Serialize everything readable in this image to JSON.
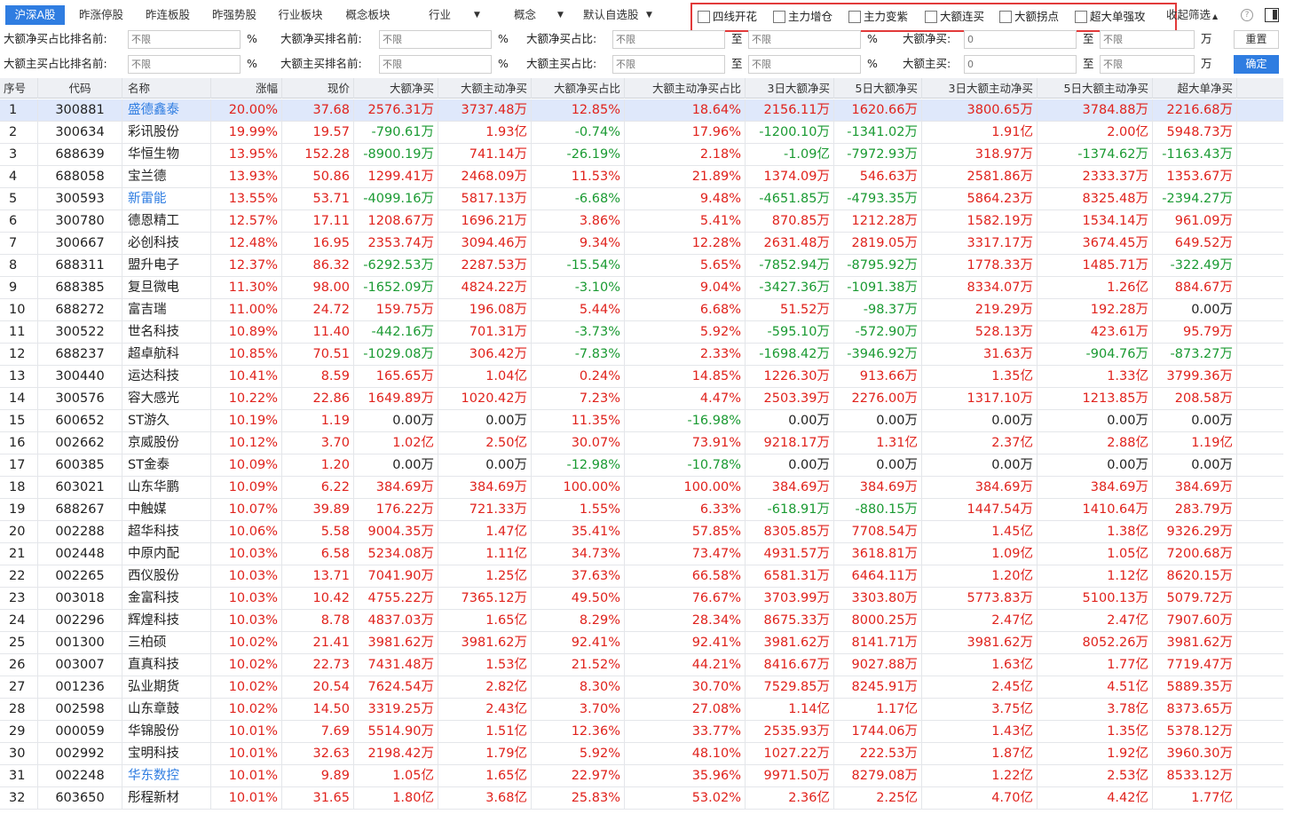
{
  "tabs": [
    "沪深A股",
    "昨涨停股",
    "昨连板股",
    "昨强势股",
    "行业板块",
    "概念板块"
  ],
  "active_tab": 0,
  "dropdowns": [
    "行业",
    "概念",
    "默认自选股"
  ],
  "checkboxes": [
    "四线开花",
    "主力增仓",
    "主力变紫",
    "大额连买",
    "大额拐点",
    "超大单强攻"
  ],
  "collapse_label": "收起筛选",
  "filters": {
    "row1": {
      "f1": "大额净买占比排名前:",
      "f2": "大额净买排名前:",
      "f3": "大额净买占比:",
      "f4": "大额净买:"
    },
    "row2": {
      "f1": "大额主买占比排名前:",
      "f2": "大额主买排名前:",
      "f3": "大额主买占比:",
      "f4": "大额主买:"
    },
    "placeholder": "不限",
    "zero_value": "0",
    "to": "至",
    "pct": "%",
    "unit": "万",
    "reset": "重置",
    "confirm": "确定"
  },
  "columns": [
    "序号",
    "代码",
    "名称",
    "涨幅",
    "现价",
    "大额净买",
    "大额主动净买",
    "大额净买占比",
    "大额主动净买占比",
    "3日大额净买",
    "5日大额净买",
    "3日大额主动净买",
    "5日大额主动净买",
    "超大单净买"
  ],
  "rows": [
    [
      "1",
      "300881",
      "盛德鑫泰",
      "20.00%",
      "37.68",
      "2576.31万",
      "3737.48万",
      "12.85%",
      "18.64%",
      "2156.11万",
      "1620.66万",
      "3800.65万",
      "3784.88万",
      "2216.68万"
    ],
    [
      "2",
      "300634",
      "彩讯股份",
      "19.99%",
      "19.57",
      "-790.61万",
      "1.93亿",
      "-0.74%",
      "17.96%",
      "-1200.10万",
      "-1341.02万",
      "1.91亿",
      "2.00亿",
      "5948.73万"
    ],
    [
      "3",
      "688639",
      "华恒生物",
      "13.95%",
      "152.28",
      "-8900.19万",
      "741.14万",
      "-26.19%",
      "2.18%",
      "-1.09亿",
      "-7972.93万",
      "318.97万",
      "-1374.62万",
      "-1163.43万"
    ],
    [
      "4",
      "688058",
      "宝兰德",
      "13.93%",
      "50.86",
      "1299.41万",
      "2468.09万",
      "11.53%",
      "21.89%",
      "1374.09万",
      "546.63万",
      "2581.86万",
      "2333.37万",
      "1353.67万"
    ],
    [
      "5",
      "300593",
      "新雷能",
      "13.55%",
      "53.71",
      "-4099.16万",
      "5817.13万",
      "-6.68%",
      "9.48%",
      "-4651.85万",
      "-4793.35万",
      "5864.23万",
      "8325.48万",
      "-2394.27万"
    ],
    [
      "6",
      "300780",
      "德恩精工",
      "12.57%",
      "17.11",
      "1208.67万",
      "1696.21万",
      "3.86%",
      "5.41%",
      "870.85万",
      "1212.28万",
      "1582.19万",
      "1534.14万",
      "961.09万"
    ],
    [
      "7",
      "300667",
      "必创科技",
      "12.48%",
      "16.95",
      "2353.74万",
      "3094.46万",
      "9.34%",
      "12.28%",
      "2631.48万",
      "2819.05万",
      "3317.17万",
      "3674.45万",
      "649.52万"
    ],
    [
      "8",
      "688311",
      "盟升电子",
      "12.37%",
      "86.32",
      "-6292.53万",
      "2287.53万",
      "-15.54%",
      "5.65%",
      "-7852.94万",
      "-8795.92万",
      "1778.33万",
      "1485.71万",
      "-322.49万"
    ],
    [
      "9",
      "688385",
      "复旦微电",
      "11.30%",
      "98.00",
      "-1652.09万",
      "4824.22万",
      "-3.10%",
      "9.04%",
      "-3427.36万",
      "-1091.38万",
      "8334.07万",
      "1.26亿",
      "884.67万"
    ],
    [
      "10",
      "688272",
      "富吉瑞",
      "11.00%",
      "24.72",
      "159.75万",
      "196.08万",
      "5.44%",
      "6.68%",
      "51.52万",
      "-98.37万",
      "219.29万",
      "192.28万",
      "0.00万"
    ],
    [
      "11",
      "300522",
      "世名科技",
      "10.89%",
      "11.40",
      "-442.16万",
      "701.31万",
      "-3.73%",
      "5.92%",
      "-595.10万",
      "-572.90万",
      "528.13万",
      "423.61万",
      "95.79万"
    ],
    [
      "12",
      "688237",
      "超卓航科",
      "10.85%",
      "70.51",
      "-1029.08万",
      "306.42万",
      "-7.83%",
      "2.33%",
      "-1698.42万",
      "-3946.92万",
      "31.63万",
      "-904.76万",
      "-873.27万"
    ],
    [
      "13",
      "300440",
      "运达科技",
      "10.41%",
      "8.59",
      "165.65万",
      "1.04亿",
      "0.24%",
      "14.85%",
      "1226.30万",
      "913.66万",
      "1.35亿",
      "1.33亿",
      "3799.36万"
    ],
    [
      "14",
      "300576",
      "容大感光",
      "10.22%",
      "22.86",
      "1649.89万",
      "1020.42万",
      "7.23%",
      "4.47%",
      "2503.39万",
      "2276.00万",
      "1317.10万",
      "1213.85万",
      "208.58万"
    ],
    [
      "15",
      "600652",
      "ST游久",
      "10.19%",
      "1.19",
      "0.00万",
      "0.00万",
      "11.35%",
      "-16.98%",
      "0.00万",
      "0.00万",
      "0.00万",
      "0.00万",
      "0.00万"
    ],
    [
      "16",
      "002662",
      "京威股份",
      "10.12%",
      "3.70",
      "1.02亿",
      "2.50亿",
      "30.07%",
      "73.91%",
      "9218.17万",
      "1.31亿",
      "2.37亿",
      "2.88亿",
      "1.19亿"
    ],
    [
      "17",
      "600385",
      "ST金泰",
      "10.09%",
      "1.20",
      "0.00万",
      "0.00万",
      "-12.98%",
      "-10.78%",
      "0.00万",
      "0.00万",
      "0.00万",
      "0.00万",
      "0.00万"
    ],
    [
      "18",
      "603021",
      "山东华鹏",
      "10.09%",
      "6.22",
      "384.69万",
      "384.69万",
      "100.00%",
      "100.00%",
      "384.69万",
      "384.69万",
      "384.69万",
      "384.69万",
      "384.69万"
    ],
    [
      "19",
      "688267",
      "中触媒",
      "10.07%",
      "39.89",
      "176.22万",
      "721.33万",
      "1.55%",
      "6.33%",
      "-618.91万",
      "-880.15万",
      "1447.54万",
      "1410.64万",
      "283.79万"
    ],
    [
      "20",
      "002288",
      "超华科技",
      "10.06%",
      "5.58",
      "9004.35万",
      "1.47亿",
      "35.41%",
      "57.85%",
      "8305.85万",
      "7708.54万",
      "1.45亿",
      "1.38亿",
      "9326.29万"
    ],
    [
      "21",
      "002448",
      "中原内配",
      "10.03%",
      "6.58",
      "5234.08万",
      "1.11亿",
      "34.73%",
      "73.47%",
      "4931.57万",
      "3618.81万",
      "1.09亿",
      "1.05亿",
      "7200.68万"
    ],
    [
      "22",
      "002265",
      "西仪股份",
      "10.03%",
      "13.71",
      "7041.90万",
      "1.25亿",
      "37.63%",
      "66.58%",
      "6581.31万",
      "6464.11万",
      "1.20亿",
      "1.12亿",
      "8620.15万"
    ],
    [
      "23",
      "003018",
      "金富科技",
      "10.03%",
      "10.42",
      "4755.22万",
      "7365.12万",
      "49.50%",
      "76.67%",
      "3703.99万",
      "3303.80万",
      "5773.83万",
      "5100.13万",
      "5079.72万"
    ],
    [
      "24",
      "002296",
      "辉煌科技",
      "10.03%",
      "8.78",
      "4837.03万",
      "1.65亿",
      "8.29%",
      "28.34%",
      "8675.33万",
      "8000.25万",
      "2.47亿",
      "2.47亿",
      "7907.60万"
    ],
    [
      "25",
      "001300",
      "三柏硕",
      "10.02%",
      "21.41",
      "3981.62万",
      "3981.62万",
      "92.41%",
      "92.41%",
      "3981.62万",
      "8141.71万",
      "3981.62万",
      "8052.26万",
      "3981.62万"
    ],
    [
      "26",
      "003007",
      "直真科技",
      "10.02%",
      "22.73",
      "7431.48万",
      "1.53亿",
      "21.52%",
      "44.21%",
      "8416.67万",
      "9027.88万",
      "1.63亿",
      "1.77亿",
      "7719.47万"
    ],
    [
      "27",
      "001236",
      "弘业期货",
      "10.02%",
      "20.54",
      "7624.54万",
      "2.82亿",
      "8.30%",
      "30.70%",
      "7529.85万",
      "8245.91万",
      "2.45亿",
      "4.51亿",
      "5889.35万"
    ],
    [
      "28",
      "002598",
      "山东章鼓",
      "10.02%",
      "14.50",
      "3319.25万",
      "2.43亿",
      "3.70%",
      "27.08%",
      "1.14亿",
      "1.17亿",
      "3.75亿",
      "3.78亿",
      "8373.65万"
    ],
    [
      "29",
      "000059",
      "华锦股份",
      "10.01%",
      "7.69",
      "5514.90万",
      "1.51亿",
      "12.36%",
      "33.77%",
      "2535.93万",
      "1744.06万",
      "1.43亿",
      "1.35亿",
      "5378.12万"
    ],
    [
      "30",
      "002992",
      "宝明科技",
      "10.01%",
      "32.63",
      "2198.42万",
      "1.79亿",
      "5.92%",
      "48.10%",
      "1027.22万",
      "222.53万",
      "1.87亿",
      "1.92亿",
      "3960.30万"
    ],
    [
      "31",
      "002248",
      "华东数控",
      "10.01%",
      "9.89",
      "1.05亿",
      "1.65亿",
      "22.97%",
      "35.96%",
      "9971.50万",
      "8279.08万",
      "1.22亿",
      "2.53亿",
      "8533.12万"
    ],
    [
      "32",
      "603650",
      "彤程新材",
      "10.01%",
      "31.65",
      "1.80亿",
      "3.68亿",
      "25.83%",
      "53.02%",
      "2.36亿",
      "2.25亿",
      "4.70亿",
      "4.42亿",
      "1.77亿"
    ]
  ],
  "link_rows": [
    0,
    4,
    30
  ],
  "selected_row": 0,
  "colors": {
    "up": "#e0221c",
    "down": "#1a9a32",
    "accent": "#2f7de1",
    "highlight_border": "#e23a3a"
  }
}
